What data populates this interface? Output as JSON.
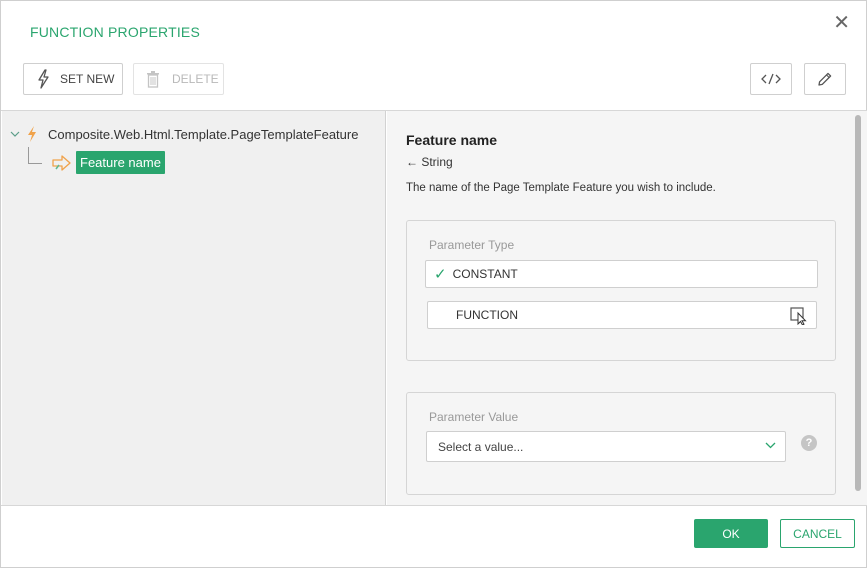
{
  "dialog": {
    "title": "FUNCTION PROPERTIES",
    "close_glyph": "✕"
  },
  "toolbar": {
    "set_new_label": "SET NEW",
    "set_new_icon": "lightning-icon",
    "delete_label": "DELETE",
    "delete_icon": "trash-icon",
    "code_icon": "code-icon",
    "edit_icon": "pencil-icon"
  },
  "tree": {
    "root_label": "Composite.Web.Html.Template.PageTemplateFeature",
    "child_label": "Feature name"
  },
  "details": {
    "name": "Feature name",
    "type": "← String",
    "description": "The name of the Page Template Feature you wish to include.",
    "parameter_type": {
      "label": "Parameter Type",
      "options": [
        "CONSTANT",
        "FUNCTION"
      ],
      "selected": "CONSTANT"
    },
    "parameter_value": {
      "label": "Parameter Value",
      "placeholder": "Select a value...",
      "help_glyph": "?"
    }
  },
  "footer": {
    "ok_label": "OK",
    "cancel_label": "CANCEL"
  },
  "colors": {
    "accent": "#2aa56e",
    "function_icon": "#f0a24a"
  }
}
